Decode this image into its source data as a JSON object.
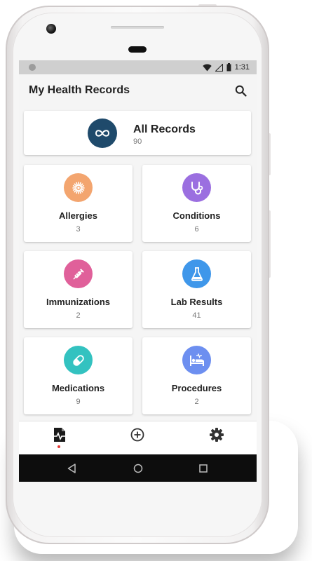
{
  "status_bar": {
    "time": "1:31"
  },
  "app_bar": {
    "title": "My Health Records"
  },
  "all_records": {
    "label": "All Records",
    "count": "90",
    "color": "#1f4a6b"
  },
  "categories": [
    {
      "label": "Allergies",
      "count": "3",
      "color": "#f3a56f",
      "icon": "flower-icon"
    },
    {
      "label": "Conditions",
      "count": "6",
      "color": "#9b6fe0",
      "icon": "stethoscope-icon"
    },
    {
      "label": "Immunizations",
      "count": "2",
      "color": "#e0609a",
      "icon": "syringe-icon"
    },
    {
      "label": "Lab Results",
      "count": "41",
      "color": "#3f97ea",
      "icon": "flask-icon"
    },
    {
      "label": "Medications",
      "count": "9",
      "color": "#33c2c0",
      "icon": "pill-icon"
    },
    {
      "label": "Procedures",
      "count": "2",
      "color": "#6d8ff0",
      "icon": "hospital-bed-icon"
    }
  ],
  "bottom_nav": {
    "items": [
      {
        "name": "records",
        "icon": "health-record-icon",
        "active": true
      },
      {
        "name": "add",
        "icon": "add-circle-icon",
        "active": false
      },
      {
        "name": "settings",
        "icon": "gear-icon",
        "active": false
      }
    ],
    "active_color": "#e53935"
  },
  "system_nav": {
    "icons": [
      "back-icon",
      "home-icon",
      "recents-icon"
    ]
  }
}
